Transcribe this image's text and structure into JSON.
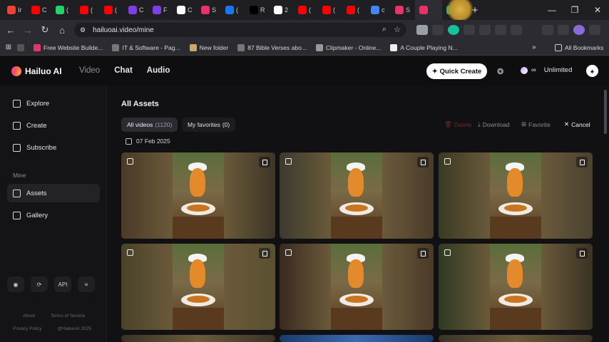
{
  "browser": {
    "tabs": [
      {
        "letter": "Ir",
        "color": "#ea4335"
      },
      {
        "letter": "C",
        "color": "#ff0000"
      },
      {
        "letter": "(",
        "color": "#25d366"
      },
      {
        "letter": "(",
        "color": "#ff0000"
      },
      {
        "letter": "(",
        "color": "#ff0000"
      },
      {
        "letter": "C",
        "color": "#7b3fe4"
      },
      {
        "letter": "F",
        "color": "#7b3fe4"
      },
      {
        "letter": "C",
        "color": "#ffffff"
      },
      {
        "letter": "S",
        "color": "#e8336a"
      },
      {
        "letter": "(",
        "color": "#1877f2"
      },
      {
        "letter": "R",
        "color": "#000000"
      },
      {
        "letter": "2",
        "color": "#ffffff"
      },
      {
        "letter": "(",
        "color": "#ff0000"
      },
      {
        "letter": "(",
        "color": "#ff0000"
      },
      {
        "letter": "(",
        "color": "#ff0000"
      },
      {
        "letter": "c",
        "color": "#4285f4"
      },
      {
        "letter": "S",
        "color": "#e8336a"
      },
      {
        "letter": "",
        "color": "#e8336a"
      },
      {
        "letter": "F",
        "color": "#2fb45a"
      }
    ],
    "new_tab_label": "+",
    "window_controls": [
      "—",
      "❐",
      "✕"
    ],
    "url": "hailuoai.video/mine",
    "bookmarks": [
      {
        "label": "",
        "color": "#555"
      },
      {
        "label": "Free Website Builde...",
        "color": "#e8336a"
      },
      {
        "label": "IT & Software - Pag...",
        "color": "#777"
      },
      {
        "label": "New folder",
        "color": "#caa96b"
      },
      {
        "label": "87 Bible Verses abo...",
        "color": "#777"
      },
      {
        "label": "Clipmaker - Online...",
        "color": "#999"
      },
      {
        "label": "A Couple Playing N...",
        "color": "#eee"
      }
    ],
    "all_bookmarks_label": "All Bookmarks"
  },
  "header": {
    "brand": "Hailuo AI",
    "nav": [
      {
        "label": "Video",
        "active": false
      },
      {
        "label": "Chat",
        "active": true
      },
      {
        "label": "Audio",
        "active": true
      }
    ],
    "quick_create_label": "Quick Create",
    "plan_label": "Unlimited",
    "plan_symbol": "∞"
  },
  "sidebar": {
    "items": [
      {
        "label": "Explore",
        "icon": "explore-icon"
      },
      {
        "label": "Create",
        "icon": "create-icon"
      },
      {
        "label": "Subscribe",
        "icon": "subscribe-icon"
      }
    ],
    "section_label": "Mine",
    "mine_items": [
      {
        "label": "Assets",
        "icon": "assets-icon",
        "active": true
      },
      {
        "label": "Gallery",
        "icon": "gallery-icon",
        "active": false
      }
    ],
    "api_label": "API",
    "footer_about": "About",
    "footer_terms": "Terms of Service",
    "footer_privacy": "Privacy Policy",
    "footer_copyright": "@HailuoAI 2025"
  },
  "main": {
    "title": "All Assets",
    "filter_all_label": "All videos",
    "filter_all_count": "(1120)",
    "filter_fav_label": "My favorites",
    "filter_fav_count": "(0)",
    "action_delete": "Delete",
    "action_download": "Download",
    "action_favorite": "Favorite",
    "action_cancel": "Cancel",
    "date_label": "07 Feb 2025",
    "cards": [
      {
        "bg_left": "#4a3a28",
        "bg_right": "#3d3526"
      },
      {
        "bg_left": "#3b3a2e",
        "bg_right": "#4a3b2a"
      },
      {
        "bg_left": "#3a3a24",
        "bg_right": "#4a4230"
      },
      {
        "bg_left": "#4a4228",
        "bg_right": "#5a5030"
      },
      {
        "bg_left": "#3a2a20",
        "bg_right": "#4a3a28"
      },
      {
        "bg_left": "#2f3a22",
        "bg_right": "#3a3224"
      }
    ]
  }
}
